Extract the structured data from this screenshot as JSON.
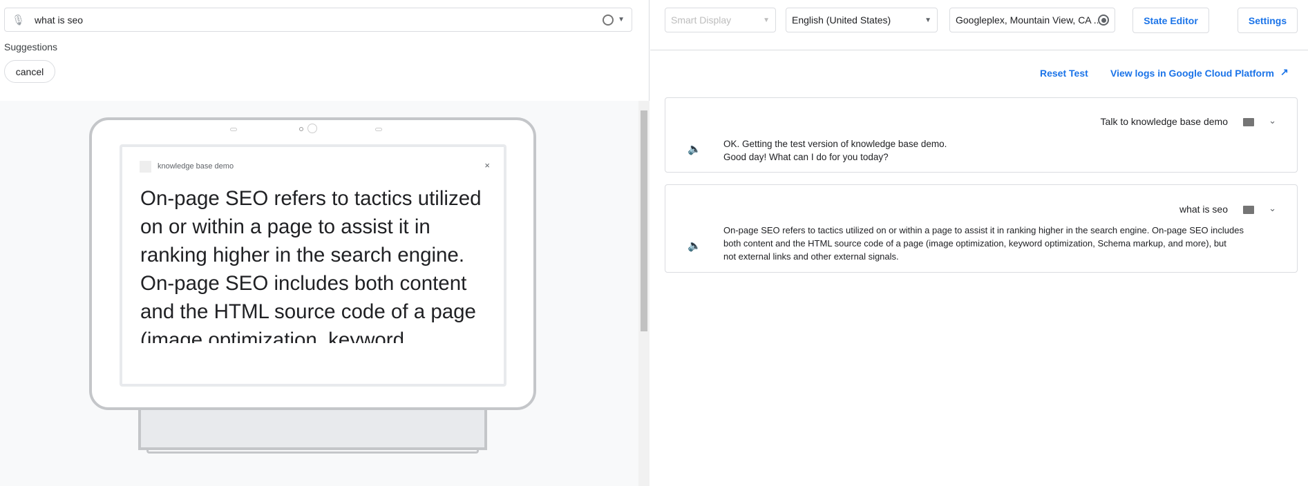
{
  "left": {
    "input": {
      "value": "what is seo",
      "mic_icon": "mic-off-icon",
      "assistant_icon": "assistant-voice-icon"
    },
    "suggestions_label": "Suggestions",
    "suggestions": [
      "cancel"
    ],
    "device": {
      "app_title": "knowledge base demo",
      "close": "×",
      "response": "On-page SEO refers to tactics utilized on or within a page to assist it in ranking higher in the search engine. On-page SEO includes both content and the HTML source code of a page (image optimization, keyword optimization, Schema markup, and more), but not external links and other external signals."
    }
  },
  "toolbar": {
    "surface": "Smart Display",
    "language": "English (United States)",
    "location": "Googleplex, Mountain View, CA ...",
    "state_editor": "State Editor",
    "settings": "Settings"
  },
  "links": {
    "reset": "Reset Test",
    "logs": "View logs in Google Cloud Platform"
  },
  "conversation": [
    {
      "query": "Talk to knowledge base demo",
      "response_lines": [
        "OK. Getting the test version of knowledge base demo.",
        "Good day! What can I do for you today?"
      ]
    },
    {
      "query": "what is seo",
      "response_lines": [
        "On-page SEO refers to tactics utilized on or within a page to assist it in ranking higher in the search engine. On-page SEO includes",
        "both content and the HTML source code of a page (image optimization, keyword optimization, Schema markup, and more), but",
        "not external links and other external signals."
      ]
    }
  ],
  "colors": {
    "accent": "#1a73e8",
    "border": "#dadce0"
  }
}
